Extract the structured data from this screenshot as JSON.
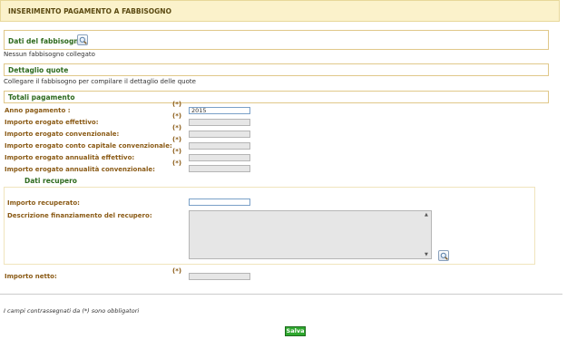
{
  "header": {
    "title": "INSERIMENTO PAGAMENTO A FABBISOGNO"
  },
  "dati_fabbisogno": {
    "title": "Dati del fabbisogno",
    "note": "Nessun fabbisogno collegato",
    "search_icon": "magnifier-icon"
  },
  "dettaglio_quote": {
    "title": "Dettaglio quote",
    "note": "Collegare il fabbisogno per compilare il dettaglio delle quote"
  },
  "totali": {
    "title": "Totali pagamento",
    "required_marker": "(*)",
    "fields": [
      {
        "label": "Anno pagamento :",
        "value": "2015"
      },
      {
        "label": "Importo erogato effettivo:",
        "value": ""
      },
      {
        "label": "Importo erogato convenzionale:",
        "value": ""
      },
      {
        "label": "Importo erogato conto capitale convenzionale:",
        "value": ""
      },
      {
        "label": "Importo erogato annualità effettivo:",
        "value": ""
      },
      {
        "label": "Importo erogato annualità convenzionale:",
        "value": ""
      }
    ]
  },
  "recupero": {
    "title": "Dati recupero",
    "importo_label": "Importo recuperato:",
    "importo_value": "",
    "descrizione_label": "Descrizione finanziamento del recupero:",
    "descrizione_value": "",
    "search_icon": "magnifier-icon"
  },
  "netto": {
    "label": "Importo netto:",
    "required_marker": "(*)",
    "value": ""
  },
  "footer": {
    "note": "I campi contrassegnati da (*) sono obbligatori",
    "save_label": "Salva"
  }
}
